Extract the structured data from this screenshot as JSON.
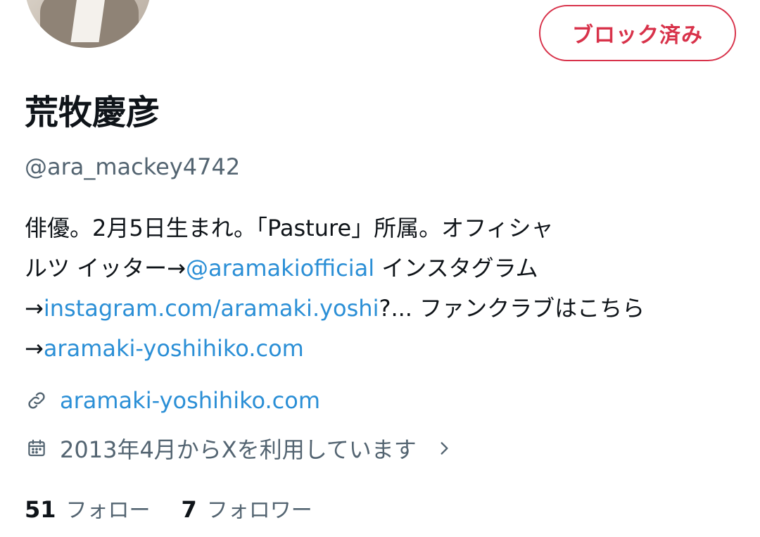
{
  "profile": {
    "block_button_label": "ブロック済み",
    "display_name": "荒牧慶彦",
    "handle": "@ara_mackey4742",
    "bio": {
      "line1": "俳優。2月5日生まれ。「Pasture」所属。オフィシャ",
      "line2_prefix": "ルツ イッター→",
      "line2_mention": "@aramakiofficial",
      "line2_suffix": " インスタグラム",
      "line3_prefix": "→",
      "line3_link": "instagram.com/aramaki.yoshi",
      "line3_suffix": "?... ファンクラブはこちら",
      "line4_prefix": "→",
      "line4_link": "aramaki-yoshihiko.com"
    },
    "website": "aramaki-yoshihiko.com",
    "joined": "2013年4月からXを利用しています",
    "following_count": "51",
    "following_label": "フォロー",
    "followers_count": "7",
    "followers_label": "フォロワー"
  },
  "icons": {
    "website": "link-icon",
    "joined": "calendar-icon",
    "more": "chevron-right-icon"
  },
  "colors": {
    "accent": "#2b8fd6",
    "block": "#d8324a",
    "secondary_text": "#536471",
    "primary_text": "#0f1419"
  }
}
